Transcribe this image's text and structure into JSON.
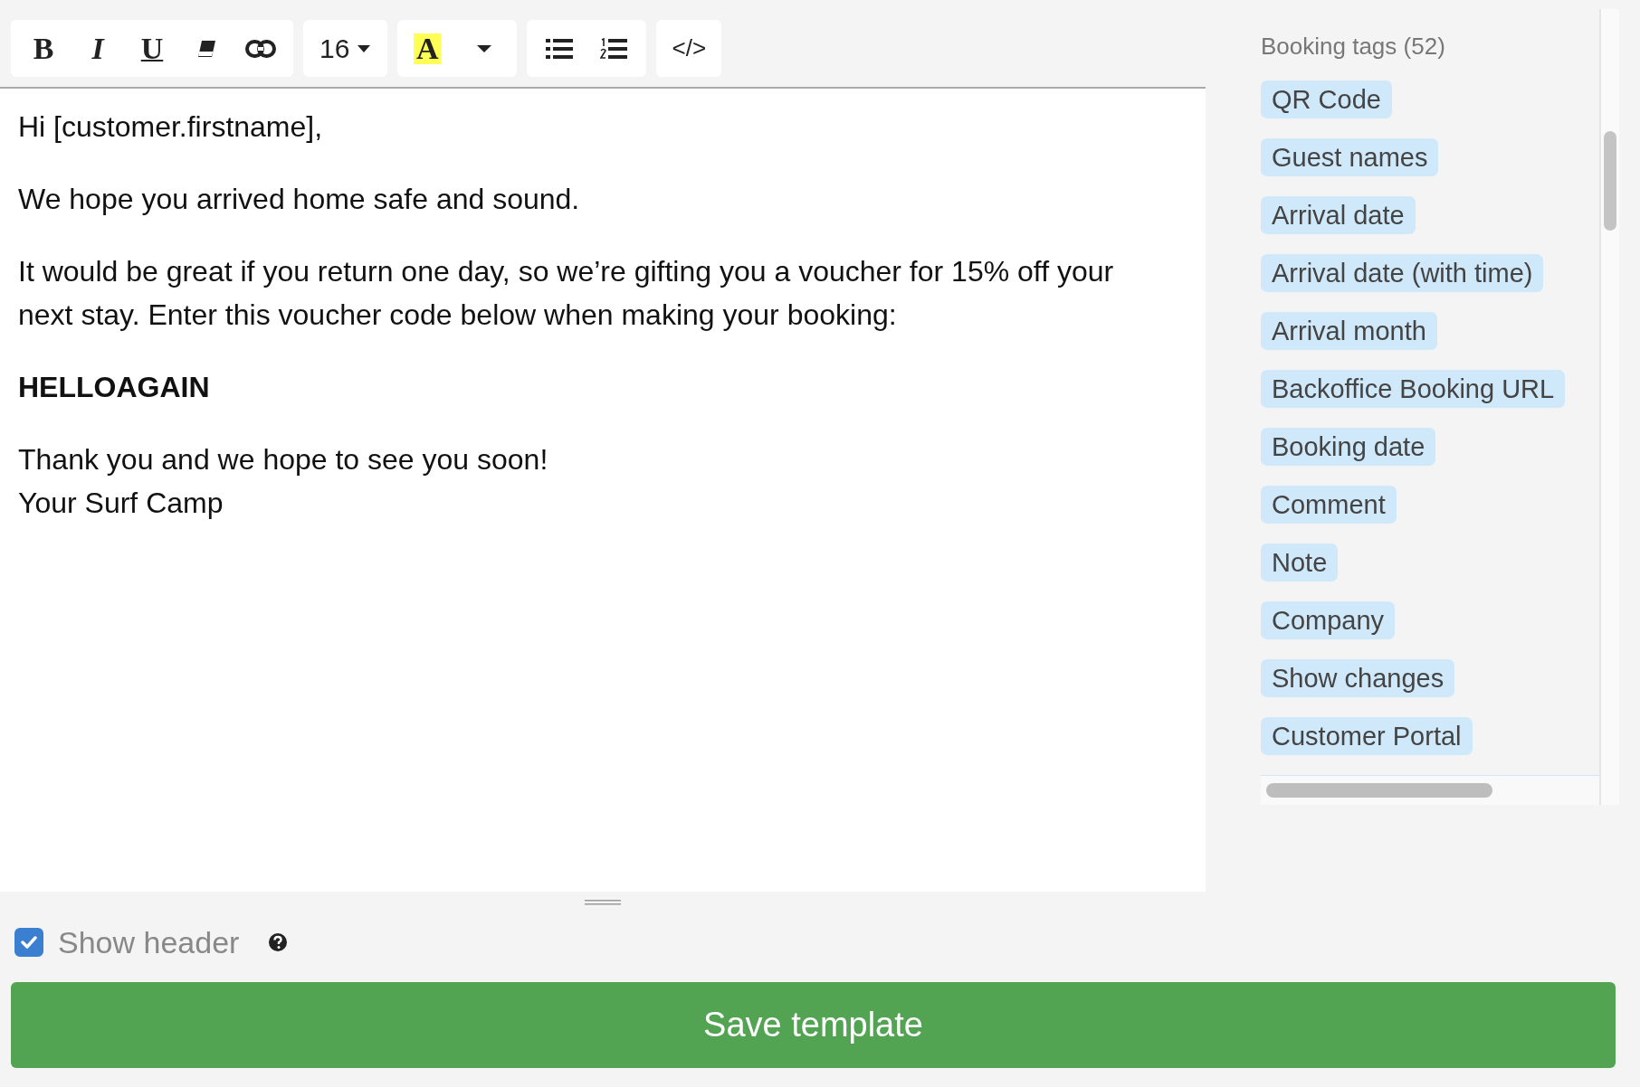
{
  "toolbar": {
    "groups": [
      {
        "buttons": [
          {
            "kind": "bold",
            "label": "B"
          },
          {
            "kind": "italic",
            "label": "I"
          },
          {
            "kind": "underline",
            "label": "U"
          },
          {
            "kind": "eraser"
          },
          {
            "kind": "link"
          }
        ]
      },
      {
        "buttons": [
          {
            "kind": "size",
            "label": "16"
          }
        ]
      },
      {
        "buttons": [
          {
            "kind": "color",
            "label": "A"
          },
          {
            "kind": "caret"
          }
        ]
      },
      {
        "buttons": [
          {
            "kind": "bullets"
          },
          {
            "kind": "numbers"
          }
        ]
      },
      {
        "buttons": [
          {
            "kind": "code",
            "label": "</>"
          }
        ]
      }
    ]
  },
  "editor": {
    "paragraphs": [
      {
        "kind": "text",
        "lines": [
          "Hi [customer.firstname],"
        ]
      },
      {
        "kind": "text",
        "lines": [
          "We hope you arrived home safe and sound."
        ]
      },
      {
        "kind": "text",
        "lines": [
          "It would be great if you return one day, so we’re gifting you a voucher for 15% off your next stay. Enter this voucher code below when making your booking:"
        ]
      },
      {
        "kind": "bold",
        "lines": [
          "HELLOAGAIN"
        ]
      },
      {
        "kind": "text",
        "lines": [
          "Thank you and we hope to see you soon!",
          "Your Surf Camp"
        ]
      }
    ]
  },
  "show_header": {
    "label": "Show header",
    "checked": true
  },
  "save_button": "Save template",
  "tags_panel": {
    "title": "Booking tags (52)",
    "tags": [
      "QR Code",
      "Guest names",
      "Arrival date",
      "Arrival date (with time)",
      "Arrival month",
      "Backoffice Booking URL",
      "Booking date",
      "Comment",
      "Note",
      "Company",
      "Show changes",
      "Customer Portal"
    ]
  }
}
